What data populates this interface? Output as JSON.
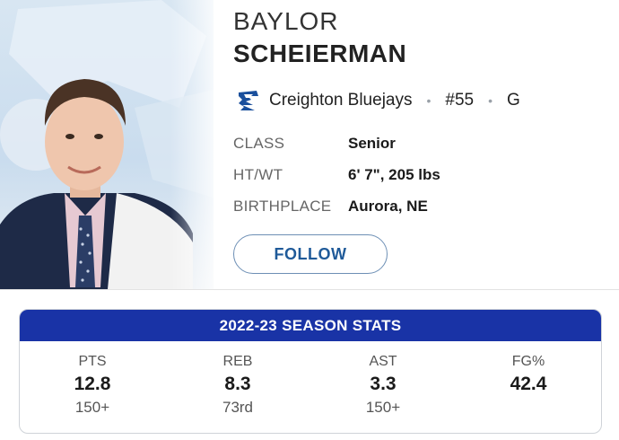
{
  "player": {
    "first_name": "BAYLOR",
    "last_name": "SCHEIERMAN",
    "team": "Creighton Bluejays",
    "number": "#55",
    "position": "G",
    "separator": "•"
  },
  "info": [
    {
      "key": "CLASS",
      "value": "Senior"
    },
    {
      "key": "HT/WT",
      "value": "6' 7\", 205 lbs"
    },
    {
      "key": "BIRTHPLACE",
      "value": "Aurora, NE"
    }
  ],
  "follow_label": "FOLLOW",
  "stats": {
    "title": "2022-23 SEASON STATS",
    "items": [
      {
        "label": "PTS",
        "value": "12.8",
        "rank": "150+"
      },
      {
        "label": "REB",
        "value": "8.3",
        "rank": "73rd"
      },
      {
        "label": "AST",
        "value": "3.3",
        "rank": "150+"
      },
      {
        "label": "FG%",
        "value": "42.4",
        "rank": ""
      }
    ]
  },
  "colors": {
    "header_blue": "#1933a6",
    "follow_text": "#1f5a99",
    "team_blue": "#1a4f9c"
  },
  "icons": {
    "team_logo": "creighton-bluejays-logo"
  }
}
